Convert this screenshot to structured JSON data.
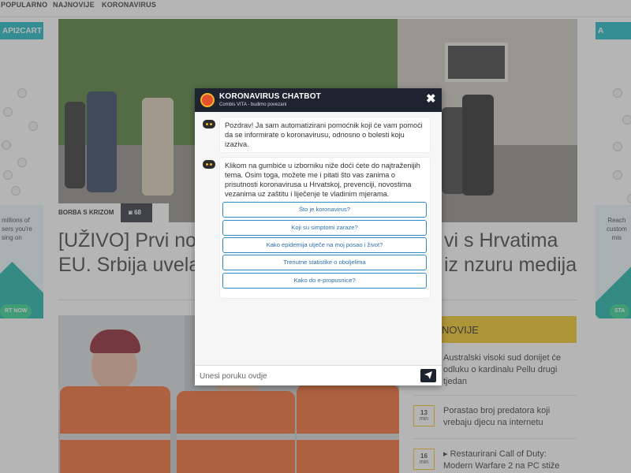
{
  "nav": {
    "items": [
      "POPULARNO",
      "NAJNOVIJE",
      "KORONAVIRUS"
    ]
  },
  "ads": {
    "left": {
      "brand": "API2CART",
      "text_lines": [
        "millions of",
        "sers you're",
        "sing on"
      ],
      "button": "RT NOW"
    },
    "right": {
      "brand": "A",
      "text_lines": [
        "Reach",
        "custom",
        "mis"
      ],
      "button": "STA"
    }
  },
  "article": {
    "category": "BORBA S KRIZOM",
    "photo_count": "68",
    "headline": "[UŽIVO] Prvi novi slučaj koronavirusa u Srbiji s Hrvatima iz EU. Srbija uvela potpunu zabranu i poziva na cenzuru medija",
    "headline_visible_left_1": "[UŽIVO] Prvi nov",
    "headline_visible_right_1": "vi s Hrvatima iz",
    "headline_visible_left_2": "EU. Srbija uvela p",
    "headline_visible_right_2": "nzuru medija"
  },
  "news": {
    "header": "NOVIJE",
    "items": [
      {
        "time": "",
        "unit": "",
        "text": "Australski visoki sud donijet će odluku o kardinalu Pellu drugi tjedan"
      },
      {
        "time": "13",
        "unit": "min",
        "text": "Porastao broj predatora koji vrebaju djecu na internetu"
      },
      {
        "time": "16",
        "unit": "min",
        "text": "▸ Restaurirani Call of Duty: Modern Warfare 2 na PC stiže"
      }
    ]
  },
  "chat": {
    "title": "KORONAVIRUS CHATBOT",
    "subtitle": "Combis VITA - budimo povezani",
    "close": "✖",
    "messages": [
      "Pozdrav! Ja sam automatizirani pomoćnik koji će vam pomoći da se informirate o koronavirusu, odnosno o bolesti koju izaziva.",
      "Klikom na gumbiće u izborniku niže doći ćete do najtraženijih tema. Osim toga, možete me i pitati što vas zanima o prisutnosti koronavirusa u Hrvatskoj, prevenciji, novostima vezanima uz zaštitu i liječenje te vladinim mjerama."
    ],
    "options": [
      "Što je koronavirus?",
      "Koji su simptomi zaraze?",
      "Kako epidemija utječe na moj posao i život?",
      "Trenutne statistike o oboljelima",
      "Kako do e-propusnice?"
    ],
    "input_placeholder": "Unesi poruku ovdje"
  },
  "colors": {
    "chat_header": "#1d2430",
    "accent_yellow": "#f3c51c",
    "option_border": "#2b8ac7",
    "ad_teal": "#17b7c4"
  }
}
